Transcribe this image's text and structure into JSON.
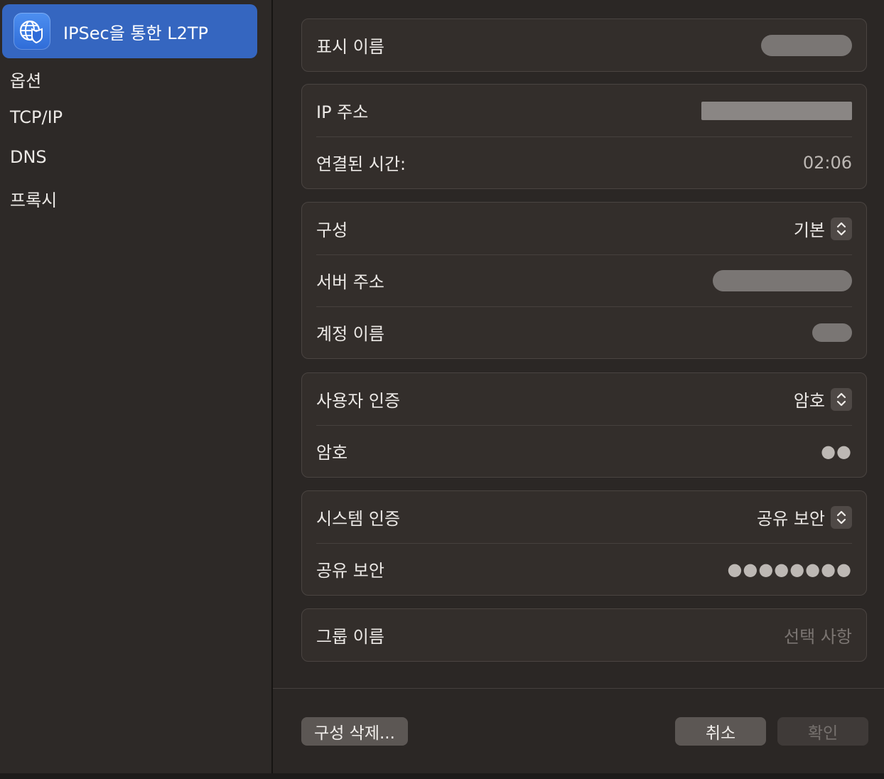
{
  "sidebar": {
    "selected_label": "IPSec을 통한 L2TP",
    "items": [
      {
        "label": "옵션"
      },
      {
        "label": "TCP/IP"
      },
      {
        "label": "DNS"
      },
      {
        "label": "프록시"
      }
    ]
  },
  "groups": {
    "display": {
      "display_name_label": "표시 이름"
    },
    "status": {
      "ip_label": "IP 주소",
      "connected_label": "연결된 시간:",
      "connected_value": "02:06"
    },
    "config": {
      "config_label": "구성",
      "config_value": "기본",
      "server_label": "서버 주소",
      "account_label": "계정 이름"
    },
    "user_auth": {
      "label": "사용자 인증",
      "value": "암호",
      "password_label": "암호",
      "password_dots": "●●"
    },
    "system_auth": {
      "label": "시스템 인증",
      "value": "공유 보안",
      "secret_label": "공유 보안",
      "secret_dots": "●●●●●●●●"
    },
    "group_name": {
      "label": "그룹 이름",
      "placeholder": "선택 사항"
    }
  },
  "buttons": {
    "delete": "구성 삭제...",
    "cancel": "취소",
    "ok": "확인"
  }
}
